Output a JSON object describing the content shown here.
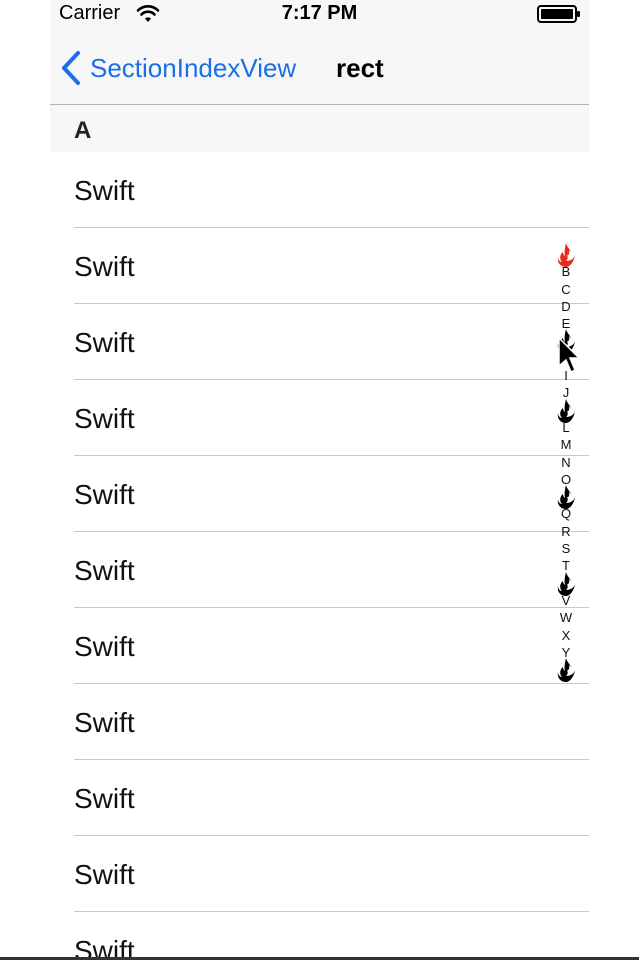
{
  "status_bar": {
    "carrier": "Carrier",
    "time": "7:17 PM"
  },
  "nav": {
    "back_label": "SectionIndexView",
    "title": "rect"
  },
  "section": {
    "header": "A"
  },
  "rows": [
    "Swift",
    "Swift",
    "Swift",
    "Swift",
    "Swift",
    "Swift",
    "Swift",
    "Swift",
    "Swift",
    "Swift",
    "Swift"
  ],
  "index_items": [
    {
      "label": "",
      "icon": "flame-icon",
      "color": "#e52b1c"
    },
    {
      "label": "B"
    },
    {
      "label": "C"
    },
    {
      "label": "D"
    },
    {
      "label": "E"
    },
    {
      "label": "",
      "icon": "flame-icon",
      "color": "#000000"
    },
    {
      "label": "H"
    },
    {
      "label": "I"
    },
    {
      "label": "J"
    },
    {
      "label": "",
      "icon": "flame-icon",
      "color": "#000000"
    },
    {
      "label": "L"
    },
    {
      "label": "M"
    },
    {
      "label": "N"
    },
    {
      "label": "O"
    },
    {
      "label": "",
      "icon": "flame-icon",
      "color": "#000000"
    },
    {
      "label": "Q"
    },
    {
      "label": "R"
    },
    {
      "label": "S"
    },
    {
      "label": "T"
    },
    {
      "label": "",
      "icon": "flame-icon",
      "color": "#000000"
    },
    {
      "label": "V"
    },
    {
      "label": "W"
    },
    {
      "label": "X"
    },
    {
      "label": "Y"
    },
    {
      "label": "",
      "icon": "flame-icon",
      "color": "#000000"
    }
  ],
  "colors": {
    "accent": "#1a6fe8",
    "separator": "#c8c7cc",
    "bar_bg": "#f7f7f7"
  }
}
